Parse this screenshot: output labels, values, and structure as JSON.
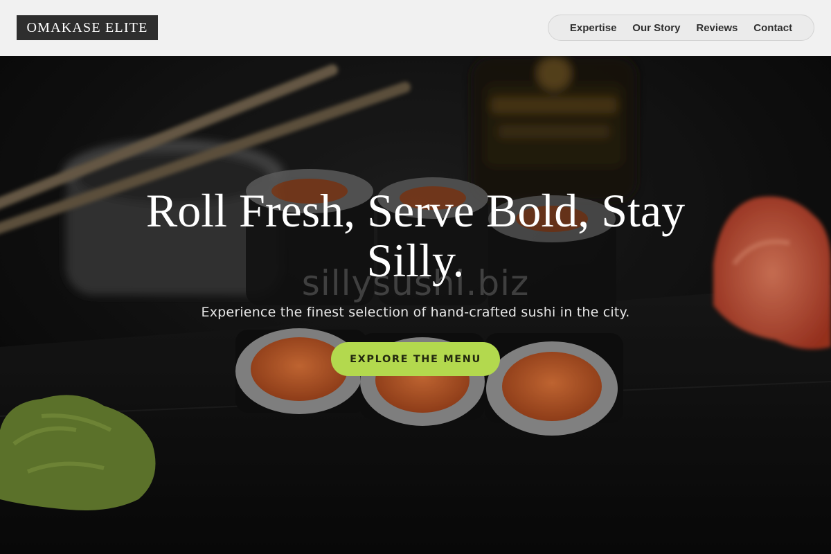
{
  "brand": {
    "name": "OMAKASE ELITE"
  },
  "nav": {
    "items": [
      {
        "label": "Expertise"
      },
      {
        "label": "Our Story"
      },
      {
        "label": "Reviews"
      },
      {
        "label": "Contact"
      }
    ]
  },
  "hero": {
    "title": "Roll Fresh, Serve Bold, Stay Silly.",
    "watermark": "sillysushi.biz",
    "subtitle": "Experience the finest selection of hand-crafted sushi in the city.",
    "cta_label": "EXPLORE THE MENU"
  },
  "colors": {
    "header_bg": "#f1f1f1",
    "logo_bg": "#2e2e2e",
    "cta_bg": "#b3d94e",
    "hero_text": "#ffffff"
  }
}
